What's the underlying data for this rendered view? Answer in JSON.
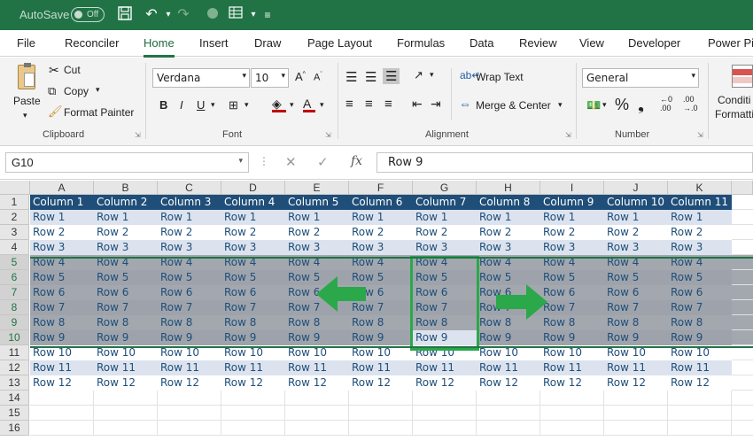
{
  "titlebar": {
    "autosave": "AutoSave",
    "toggle": "Off"
  },
  "tabs": [
    "File",
    "Reconciler",
    "Home",
    "Insert",
    "Draw",
    "Page Layout",
    "Formulas",
    "Data",
    "Review",
    "View",
    "Developer",
    "Power Pi"
  ],
  "ribbon": {
    "clipboard": {
      "paste": "Paste",
      "cut": "Cut",
      "copy": "Copy",
      "format_painter": "Format Painter",
      "label": "Clipboard"
    },
    "font": {
      "name": "Verdana",
      "size": "10",
      "label": "Font"
    },
    "alignment": {
      "wrap": "Wrap Text",
      "merge": "Merge & Center",
      "label": "Alignment"
    },
    "number": {
      "format": "General",
      "label": "Number"
    },
    "styles": {
      "cond1": "Conditi",
      "cond2": "Formatti"
    }
  },
  "formula_bar": {
    "name_box": "G10",
    "content": "Row 9"
  },
  "columns": [
    "A",
    "B",
    "C",
    "D",
    "E",
    "F",
    "G",
    "H",
    "I",
    "J",
    "K"
  ],
  "rows": [
    "1",
    "2",
    "3",
    "4",
    "5",
    "6",
    "7",
    "8",
    "9",
    "10",
    "11",
    "12",
    "13",
    "14",
    "15",
    "16"
  ],
  "headers": [
    "Column 1",
    "Column 2",
    "Column 3",
    "Column 4",
    "Column 5",
    "Column 6",
    "Column 7",
    "Column 8",
    "Column 9",
    "Column 10",
    "Column 11"
  ],
  "row_values": [
    "Row 1",
    "Row 2",
    "Row 3",
    "Row 4",
    "Row 5",
    "Row 6",
    "Row 7",
    "Row 8",
    "Row 9",
    "Row 10",
    "Row 11",
    "Row 12"
  ],
  "colors": {
    "excel_green": "#217346",
    "header_blue": "#1f4e79",
    "band_light": "#dce3ee",
    "arrow_green": "#2aa84a",
    "selection": "#a0a4ad"
  }
}
